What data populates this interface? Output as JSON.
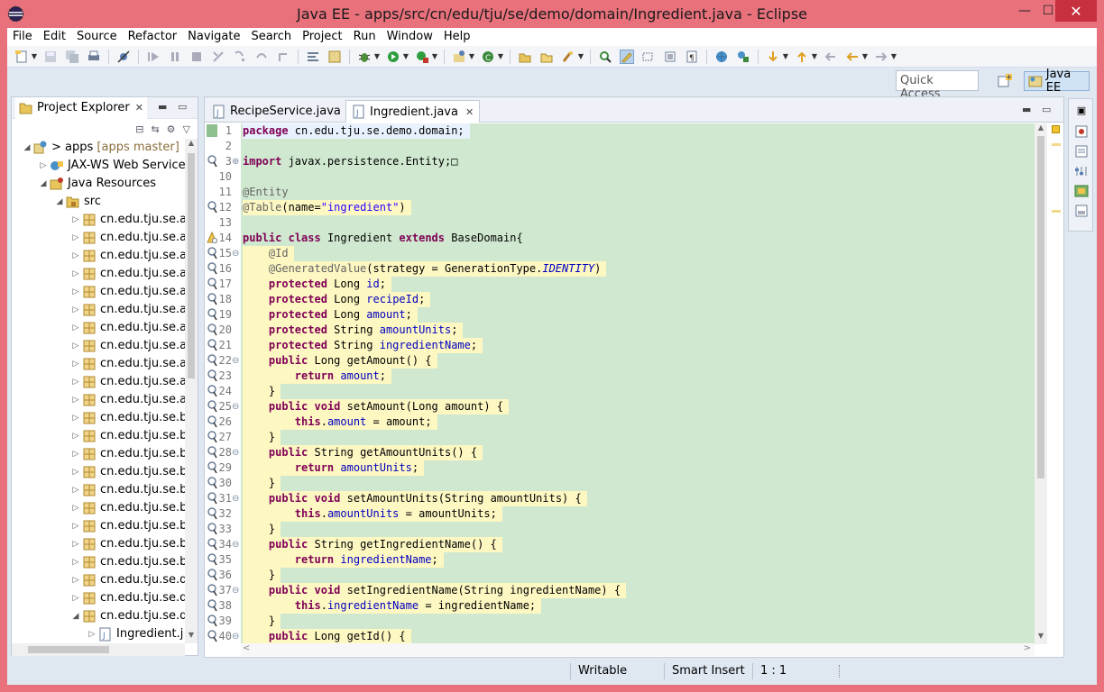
{
  "window": {
    "title": "Java EE - apps/src/cn/edu/tju/se/demo/domain/Ingredient.java - Eclipse",
    "min_glyph": "—",
    "max_glyph": "☐",
    "close_glyph": "✕"
  },
  "menu": [
    "File",
    "Edit",
    "Source",
    "Refactor",
    "Navigate",
    "Search",
    "Project",
    "Run",
    "Window",
    "Help"
  ],
  "quick_access": {
    "placeholder": "Quick Access"
  },
  "perspective": {
    "label": "Java EE"
  },
  "project_explorer": {
    "title": "Project Explorer",
    "tree": [
      {
        "level": 0,
        "expanded": true,
        "label": "apps",
        "prefix": "> ",
        "decoration": "[apps master]",
        "icon": "project-icon"
      },
      {
        "level": 1,
        "expanded": false,
        "label": "JAX-WS Web Services",
        "icon": "web-services-icon"
      },
      {
        "level": 1,
        "expanded": true,
        "label": "Java Resources",
        "icon": "java-resources-icon"
      },
      {
        "level": 2,
        "expanded": true,
        "label": "src",
        "icon": "source-folder-icon"
      },
      {
        "level": 3,
        "expanded": false,
        "label": "cn.edu.tju.se.att",
        "icon": "package-icon"
      },
      {
        "level": 3,
        "expanded": false,
        "label": "cn.edu.tju.se.att",
        "icon": "package-icon"
      },
      {
        "level": 3,
        "expanded": false,
        "label": "cn.edu.tju.se.att",
        "icon": "package-icon"
      },
      {
        "level": 3,
        "expanded": false,
        "label": "cn.edu.tju.se.att",
        "icon": "package-icon"
      },
      {
        "level": 3,
        "expanded": false,
        "label": "cn.edu.tju.se.att",
        "icon": "package-icon"
      },
      {
        "level": 3,
        "expanded": false,
        "label": "cn.edu.tju.se.att",
        "icon": "package-icon"
      },
      {
        "level": 3,
        "expanded": false,
        "label": "cn.edu.tju.se.au",
        "icon": "package-icon"
      },
      {
        "level": 3,
        "expanded": false,
        "label": "cn.edu.tju.se.au",
        "icon": "package-icon"
      },
      {
        "level": 3,
        "expanded": false,
        "label": "cn.edu.tju.se.au",
        "icon": "package-icon"
      },
      {
        "level": 3,
        "expanded": false,
        "label": "cn.edu.tju.se.au",
        "icon": "package-icon"
      },
      {
        "level": 3,
        "expanded": false,
        "label": "cn.edu.tju.se.au",
        "icon": "package-icon"
      },
      {
        "level": 3,
        "expanded": false,
        "label": "cn.edu.tju.se.ba",
        "icon": "package-icon"
      },
      {
        "level": 3,
        "expanded": false,
        "label": "cn.edu.tju.se.ba",
        "icon": "package-icon"
      },
      {
        "level": 3,
        "expanded": false,
        "label": "cn.edu.tju.se.ba",
        "icon": "package-icon"
      },
      {
        "level": 3,
        "expanded": false,
        "label": "cn.edu.tju.se.ba",
        "icon": "package-icon"
      },
      {
        "level": 3,
        "expanded": false,
        "label": "cn.edu.tju.se.ba",
        "icon": "package-icon"
      },
      {
        "level": 3,
        "expanded": false,
        "label": "cn.edu.tju.se.ba",
        "icon": "package-icon"
      },
      {
        "level": 3,
        "expanded": false,
        "label": "cn.edu.tju.se.ba",
        "icon": "package-icon"
      },
      {
        "level": 3,
        "expanded": false,
        "label": "cn.edu.tju.se.ba",
        "icon": "package-icon"
      },
      {
        "level": 3,
        "expanded": false,
        "label": "cn.edu.tju.se.ba",
        "icon": "package-icon"
      },
      {
        "level": 3,
        "expanded": false,
        "label": "cn.edu.tju.se.de",
        "icon": "package-icon"
      },
      {
        "level": 3,
        "expanded": false,
        "label": "cn.edu.tju.se.de",
        "icon": "package-icon"
      },
      {
        "level": 3,
        "expanded": true,
        "label": "cn.edu.tju.se.de",
        "icon": "package-icon"
      },
      {
        "level": 4,
        "expanded": false,
        "label": "Ingredient.j",
        "icon": "java-file-icon"
      }
    ]
  },
  "editor": {
    "tabs": [
      {
        "label": "RecipeService.java",
        "active": false
      },
      {
        "label": "Ingredient.java",
        "active": true
      }
    ],
    "lines": [
      {
        "n": "1",
        "tokens": [
          [
            "kw",
            "package"
          ],
          [
            "t",
            " cn.edu.tju.se.demo.domain;"
          ]
        ],
        "hl": false,
        "current": true
      },
      {
        "n": "2",
        "tokens": [],
        "hl": false
      },
      {
        "n": "3",
        "tokens": [
          [
            "kw",
            "import"
          ],
          [
            "t",
            " javax.persistence.Entity;"
          ],
          [
            "t",
            "□"
          ]
        ],
        "hl": false,
        "fold": "⊕"
      },
      {
        "n": "10",
        "tokens": [],
        "hl": false
      },
      {
        "n": "11",
        "tokens": [
          [
            "ann",
            "@Entity"
          ]
        ],
        "hl": false
      },
      {
        "n": "12",
        "tokens": [
          [
            "ann",
            "@Table"
          ],
          [
            "t",
            "(name="
          ],
          [
            "str",
            "\"ingredient\""
          ],
          [
            "t",
            ")"
          ]
        ],
        "hl": true
      },
      {
        "n": "13",
        "tokens": [],
        "hl": false
      },
      {
        "n": "14",
        "tokens": [
          [
            "kw",
            "public"
          ],
          [
            "t",
            " "
          ],
          [
            "kw",
            "class"
          ],
          [
            "t",
            " Ingredient "
          ],
          [
            "kw",
            "extends"
          ],
          [
            "t",
            " BaseDomain{"
          ]
        ],
        "hl": false
      },
      {
        "n": "15",
        "tokens": [
          [
            "t",
            "    "
          ],
          [
            "ann",
            "@Id"
          ]
        ],
        "hl": true,
        "fold": "⊖"
      },
      {
        "n": "16",
        "tokens": [
          [
            "t",
            "    "
          ],
          [
            "ann",
            "@GeneratedValue"
          ],
          [
            "t",
            "(strategy = GenerationType."
          ],
          [
            "cst",
            "IDENTITY"
          ],
          [
            "t",
            ")"
          ]
        ],
        "hl": true
      },
      {
        "n": "17",
        "tokens": [
          [
            "t",
            "    "
          ],
          [
            "kw",
            "protected"
          ],
          [
            "t",
            " Long "
          ],
          [
            "fld",
            "id"
          ],
          [
            "t",
            ";"
          ]
        ],
        "hl": true
      },
      {
        "n": "18",
        "tokens": [
          [
            "t",
            "    "
          ],
          [
            "kw",
            "protected"
          ],
          [
            "t",
            " Long "
          ],
          [
            "fld",
            "recipeId"
          ],
          [
            "t",
            ";"
          ]
        ],
        "hl": true
      },
      {
        "n": "19",
        "tokens": [
          [
            "t",
            "    "
          ],
          [
            "kw",
            "protected"
          ],
          [
            "t",
            " Long "
          ],
          [
            "fld",
            "amount"
          ],
          [
            "t",
            ";"
          ]
        ],
        "hl": true
      },
      {
        "n": "20",
        "tokens": [
          [
            "t",
            "    "
          ],
          [
            "kw",
            "protected"
          ],
          [
            "t",
            " String "
          ],
          [
            "fld",
            "amountUnits"
          ],
          [
            "t",
            ";"
          ]
        ],
        "hl": true
      },
      {
        "n": "21",
        "tokens": [
          [
            "t",
            "    "
          ],
          [
            "kw",
            "protected"
          ],
          [
            "t",
            " String "
          ],
          [
            "fld",
            "ingredientName"
          ],
          [
            "t",
            ";"
          ]
        ],
        "hl": true
      },
      {
        "n": "22",
        "tokens": [
          [
            "t",
            "    "
          ],
          [
            "kw",
            "public"
          ],
          [
            "t",
            " Long getAmount() {"
          ]
        ],
        "hl": true,
        "fold": "⊖"
      },
      {
        "n": "23",
        "tokens": [
          [
            "t",
            "        "
          ],
          [
            "kw",
            "return"
          ],
          [
            "t",
            " "
          ],
          [
            "fld",
            "amount"
          ],
          [
            "t",
            ";"
          ]
        ],
        "hl": true
      },
      {
        "n": "24",
        "tokens": [
          [
            "t",
            "    }"
          ]
        ],
        "hl": true
      },
      {
        "n": "25",
        "tokens": [
          [
            "t",
            "    "
          ],
          [
            "kw",
            "public"
          ],
          [
            "t",
            " "
          ],
          [
            "kw",
            "void"
          ],
          [
            "t",
            " setAmount(Long amount) {"
          ]
        ],
        "hl": true,
        "fold": "⊖"
      },
      {
        "n": "26",
        "tokens": [
          [
            "t",
            "        "
          ],
          [
            "kw",
            "this"
          ],
          [
            "t",
            "."
          ],
          [
            "fld",
            "amount"
          ],
          [
            "t",
            " = amount;"
          ]
        ],
        "hl": true
      },
      {
        "n": "27",
        "tokens": [
          [
            "t",
            "    }"
          ]
        ],
        "hl": true
      },
      {
        "n": "28",
        "tokens": [
          [
            "t",
            "    "
          ],
          [
            "kw",
            "public"
          ],
          [
            "t",
            " String getAmountUnits() {"
          ]
        ],
        "hl": true,
        "fold": "⊖"
      },
      {
        "n": "29",
        "tokens": [
          [
            "t",
            "        "
          ],
          [
            "kw",
            "return"
          ],
          [
            "t",
            " "
          ],
          [
            "fld",
            "amountUnits"
          ],
          [
            "t",
            ";"
          ]
        ],
        "hl": true
      },
      {
        "n": "30",
        "tokens": [
          [
            "t",
            "    }"
          ]
        ],
        "hl": true
      },
      {
        "n": "31",
        "tokens": [
          [
            "t",
            "    "
          ],
          [
            "kw",
            "public"
          ],
          [
            "t",
            " "
          ],
          [
            "kw",
            "void"
          ],
          [
            "t",
            " setAmountUnits(String amountUnits) {"
          ]
        ],
        "hl": true,
        "fold": "⊖"
      },
      {
        "n": "32",
        "tokens": [
          [
            "t",
            "        "
          ],
          [
            "kw",
            "this"
          ],
          [
            "t",
            "."
          ],
          [
            "fld",
            "amountUnits"
          ],
          [
            "t",
            " = amountUnits;"
          ]
        ],
        "hl": true
      },
      {
        "n": "33",
        "tokens": [
          [
            "t",
            "    }"
          ]
        ],
        "hl": true
      },
      {
        "n": "34",
        "tokens": [
          [
            "t",
            "    "
          ],
          [
            "kw",
            "public"
          ],
          [
            "t",
            " String getIngredientName() {"
          ]
        ],
        "hl": true,
        "fold": "⊖"
      },
      {
        "n": "35",
        "tokens": [
          [
            "t",
            "        "
          ],
          [
            "kw",
            "return"
          ],
          [
            "t",
            " "
          ],
          [
            "fld",
            "ingredientName"
          ],
          [
            "t",
            ";"
          ]
        ],
        "hl": true
      },
      {
        "n": "36",
        "tokens": [
          [
            "t",
            "    }"
          ]
        ],
        "hl": true
      },
      {
        "n": "37",
        "tokens": [
          [
            "t",
            "    "
          ],
          [
            "kw",
            "public"
          ],
          [
            "t",
            " "
          ],
          [
            "kw",
            "void"
          ],
          [
            "t",
            " setIngredientName(String ingredientName) {"
          ]
        ],
        "hl": true,
        "fold": "⊖"
      },
      {
        "n": "38",
        "tokens": [
          [
            "t",
            "        "
          ],
          [
            "kw",
            "this"
          ],
          [
            "t",
            "."
          ],
          [
            "fld",
            "ingredientName"
          ],
          [
            "t",
            " = ingredientName;"
          ]
        ],
        "hl": true
      },
      {
        "n": "39",
        "tokens": [
          [
            "t",
            "    }"
          ]
        ],
        "hl": true
      },
      {
        "n": "40",
        "tokens": [
          [
            "t",
            "    "
          ],
          [
            "kw",
            "public"
          ],
          [
            "t",
            " Long getId() {"
          ]
        ],
        "hl": true,
        "fold": "⊖"
      }
    ]
  },
  "status": {
    "mode": "Writable",
    "insert": "Smart Insert",
    "position": "1 : 1"
  },
  "colors": {
    "titlebar": "#e8717c",
    "close": "#c7303f",
    "changed_block": "#cfe8cf",
    "occurrence": "#fdf7c2",
    "keyword": "#7f0055",
    "string": "#2a00ff",
    "field": "#0000c0"
  }
}
